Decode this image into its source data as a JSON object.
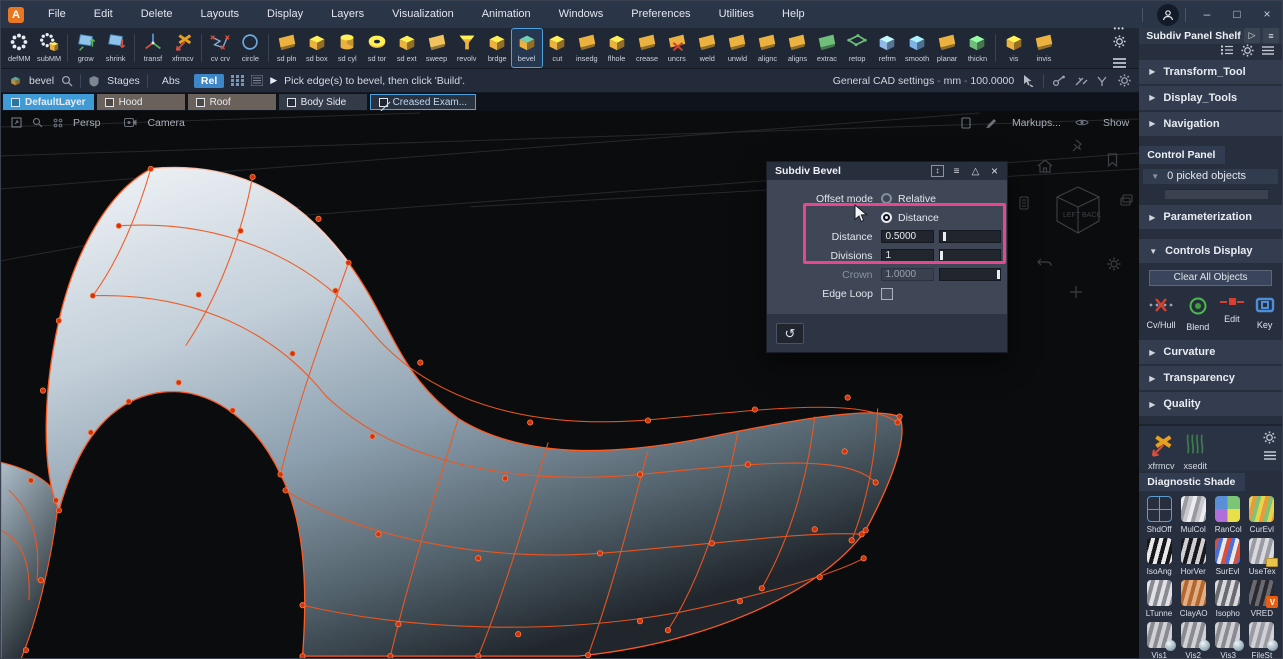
{
  "window": {
    "app_initial": "A",
    "controls": {
      "minimize": "–",
      "maximize": "□",
      "close": "×"
    }
  },
  "menu": {
    "items": [
      "File",
      "Edit",
      "Delete",
      "Layouts",
      "Display",
      "Layers",
      "Visualization",
      "Animation",
      "Windows",
      "Preferences",
      "Utilities",
      "Help"
    ]
  },
  "toolbar": {
    "overflow_dots": "•••",
    "groups": [
      {
        "items": [
          {
            "label": "defMM",
            "kind": "dots"
          },
          {
            "label": "subMM",
            "kind": "dots2"
          }
        ]
      },
      {
        "items": [
          {
            "label": "grow",
            "kind": "panel-up"
          },
          {
            "label": "shrink",
            "kind": "panel-down"
          }
        ]
      },
      {
        "items": [
          {
            "label": "transf",
            "kind": "axis"
          },
          {
            "label": "xfrmcv",
            "kind": "axis-x"
          }
        ]
      },
      {
        "items": [
          {
            "label": "cv crv",
            "kind": "zigzag"
          },
          {
            "label": "circle",
            "kind": "ring"
          }
        ]
      },
      {
        "items": [
          {
            "label": "sd pln",
            "kind": "sheet",
            "c": "#ecb23f"
          },
          {
            "label": "sd box",
            "kind": "cube",
            "c": "#ecb23f"
          },
          {
            "label": "sd cyl",
            "kind": "cyl",
            "c": "#ecb23f"
          },
          {
            "label": "sd tor",
            "kind": "torus",
            "c": "#ecb23f"
          },
          {
            "label": "sd ext",
            "kind": "cube",
            "c": "#ecb23f"
          },
          {
            "label": "sweep",
            "kind": "sheet",
            "c": "#f0c35e"
          },
          {
            "label": "revolv",
            "kind": "funnel",
            "c": "#ecb23f"
          },
          {
            "label": "brdge",
            "kind": "cube",
            "c": "#ecb23f"
          },
          {
            "label": "bevel",
            "kind": "cube-teal",
            "c": "#ecb23f",
            "selected": true
          },
          {
            "label": "cut",
            "kind": "cube",
            "c": "#ecb23f"
          },
          {
            "label": "insedg",
            "kind": "sheet",
            "c": "#ecb23f"
          },
          {
            "label": "flhole",
            "kind": "cube",
            "c": "#ecb23f"
          },
          {
            "label": "crease",
            "kind": "sheet",
            "c": "#ecb23f"
          },
          {
            "label": "uncrs",
            "kind": "sheet-x",
            "c": "#ecb23f"
          },
          {
            "label": "weld",
            "kind": "sheet",
            "c": "#ecb23f"
          },
          {
            "label": "unwld",
            "kind": "sheet",
            "c": "#ecb23f"
          },
          {
            "label": "alignc",
            "kind": "sheet",
            "c": "#ecb23f"
          },
          {
            "label": "aligns",
            "kind": "sheet",
            "c": "#ecb23f"
          },
          {
            "label": "extrac",
            "kind": "sheet",
            "c": "#6fbf7a"
          },
          {
            "label": "retop",
            "kind": "plate",
            "c": "#6fbf7a"
          },
          {
            "label": "refrm",
            "kind": "cube",
            "c": "#8fb9e8"
          },
          {
            "label": "smooth",
            "kind": "cube",
            "c": "#7fb3e8"
          },
          {
            "label": "planar",
            "kind": "sheet",
            "c": "#ecb23f"
          },
          {
            "label": "thickn",
            "kind": "cube",
            "c": "#6fbf7a"
          }
        ]
      },
      {
        "items": [
          {
            "label": "vis",
            "kind": "cube",
            "c": "#ecb23f"
          },
          {
            "label": "invis",
            "kind": "sheet",
            "c": "#ecb23f"
          }
        ]
      }
    ]
  },
  "options": {
    "tool_label": "bevel",
    "stages_label": "Stages",
    "abs_label": "Abs",
    "rel_label": "Rel",
    "prompt": "Pick edge(s) to bevel, then click 'Build'.",
    "settings_parts": [
      "General CAD settings",
      "mm",
      "100.0000"
    ],
    "separator": "-"
  },
  "layers": {
    "tabs": [
      {
        "label": "DefaultLayer",
        "style": "active"
      },
      {
        "label": "Hood",
        "style": "warm"
      },
      {
        "label": "Roof",
        "style": "warm"
      },
      {
        "label": "Body Side",
        "style": "plain"
      },
      {
        "label": "Creased Exam...",
        "style": "outlined"
      }
    ]
  },
  "viewport": {
    "view_label": "Persp",
    "camera_label": "Camera",
    "markups_label": "Markups...",
    "show_label": "Show",
    "cube": {
      "left": "LEFT",
      "back": "BACK"
    }
  },
  "dialog": {
    "title": "Subdiv Bevel",
    "offset_mode_label": "Offset mode",
    "radios": [
      {
        "label": "Relative",
        "checked": false
      },
      {
        "label": "Distance",
        "checked": true
      }
    ],
    "fields": [
      {
        "label": "Distance",
        "value": "0.5000",
        "slider": 0.07,
        "disabled": false
      },
      {
        "label": "Divisions",
        "value": "1",
        "slider": 0.02,
        "disabled": false
      },
      {
        "label": "Crown",
        "value": "1.0000",
        "slider": 0.96,
        "disabled": true
      }
    ],
    "edge_loop_label": "Edge Loop"
  },
  "right_panel": {
    "shelf_title": "Subdiv Panel Shelf",
    "sections_top": [
      "Transform_Tool",
      "Display_Tools",
      "Navigation"
    ],
    "control_panel_title": "Control Panel",
    "picked_label": "0 picked objects",
    "section_parameterization": "Parameterization",
    "section_controls_display": "Controls Display",
    "clear_button_label": "Clear All Objects",
    "control_icons": [
      {
        "label": "Cv/Hull"
      },
      {
        "label": "Blend"
      },
      {
        "label": "Edit"
      },
      {
        "label": "Key"
      }
    ],
    "sections_bottom": [
      "Curvature",
      "Transparency",
      "Quality"
    ],
    "shelf_tools": [
      {
        "label": "xfrmcv"
      },
      {
        "label": "xsedit"
      }
    ],
    "diagnostic_title": "Diagnostic Shade",
    "tiles": [
      {
        "label": "ShdOff",
        "kind": "grid",
        "colors": [
          "#5a9cd0"
        ]
      },
      {
        "label": "MulCol",
        "kind": "stripes",
        "colors": [
          "#ececf0",
          "#9a9aa2",
          "#c8c8ce"
        ]
      },
      {
        "label": "RanCol",
        "kind": "patch",
        "colors": [
          "#7cc576",
          "#e8e04a",
          "#b06fd8",
          "#5a8fd8"
        ]
      },
      {
        "label": "CurEvl",
        "kind": "stripes",
        "colors": [
          "#e8d44a",
          "#e89a3d",
          "#7cc576"
        ]
      },
      {
        "label": "IsoAng",
        "kind": "stripes",
        "colors": [
          "#17171a",
          "#e8e8ea"
        ]
      },
      {
        "label": "HorVer",
        "kind": "stripes",
        "colors": [
          "#1a1a1e",
          "#cfcfd4"
        ]
      },
      {
        "label": "SurEvl",
        "kind": "stripes",
        "colors": [
          "#d8503d",
          "#4a6fd8",
          "#e8e8ec"
        ]
      },
      {
        "label": "UseTex",
        "kind": "stripes",
        "colors": [
          "#d8d8de",
          "#9a9aa2"
        ],
        "badge": "folder"
      },
      {
        "label": "LTunne",
        "kind": "stripes",
        "colors": [
          "#e0e0e6",
          "#8a8a92"
        ]
      },
      {
        "label": "ClayAO",
        "kind": "stripes",
        "colors": [
          "#e0b084",
          "#b5672f"
        ]
      },
      {
        "label": "Isopho",
        "kind": "stripes",
        "colors": [
          "#d8d8de",
          "#6a6a72"
        ]
      },
      {
        "label": "VRED",
        "kind": "stripes",
        "colors": [
          "#2a2a2e",
          "#6a6a72"
        ],
        "badge": "V"
      },
      {
        "label": "Vis1",
        "kind": "stripes",
        "colors": [
          "#d0d0d6",
          "#8a8a92"
        ],
        "badge": "sphere"
      },
      {
        "label": "Vis2",
        "kind": "stripes",
        "colors": [
          "#d0d0d6",
          "#8a8a92"
        ],
        "badge": "sphere"
      },
      {
        "label": "Vis3",
        "kind": "stripes",
        "colors": [
          "#d0d0d6",
          "#8a8a92"
        ],
        "badge": "sphere"
      },
      {
        "label": "FileSt",
        "kind": "stripes",
        "colors": [
          "#d0d0d6",
          "#9a9aa2"
        ],
        "badge": "sphere"
      }
    ]
  },
  "colors": {
    "accent_blue": "#45a7e0",
    "highlight_pink": "#e8478f",
    "mesh_orange": "#ff5a22",
    "icon_yellow": "#ecb23f",
    "logo_orange": "#e87722"
  }
}
